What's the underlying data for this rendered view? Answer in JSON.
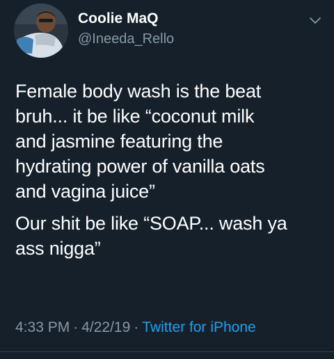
{
  "tweet": {
    "author": {
      "display_name": "Coolie MaQ",
      "handle": "@Ineeda_Rello"
    },
    "body": {
      "paragraph_1": "Female body wash is the beat\nbruh... it be like “coconut milk\nand jasmine featuring the\nhydrating power of vanilla oats\nand vagina juice”",
      "paragraph_2": "Our shit be like “SOAP... wash ya\nass nigga”"
    },
    "meta": {
      "time": "4:33 PM",
      "separator": "·",
      "date": "4/22/19",
      "source": "Twitter for iPhone"
    },
    "icons": {
      "menu": "chevron-down-icon",
      "avatar": "avatar"
    },
    "colors": {
      "background": "#15202b",
      "text": "#ffffff",
      "secondary": "#8899a6",
      "link": "#1da1f2"
    }
  }
}
